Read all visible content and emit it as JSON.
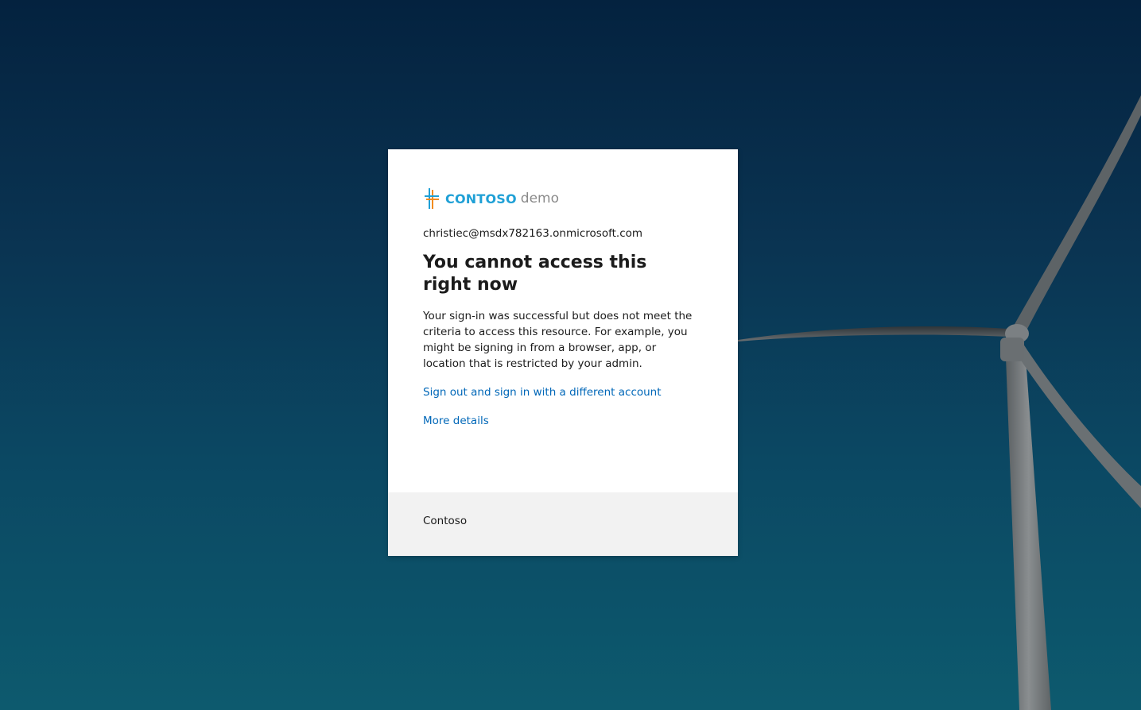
{
  "background": {
    "gradient_top": "#04223f",
    "gradient_bottom": "#0d5a6e",
    "image": "wind-turbine"
  },
  "logo": {
    "brand": "CONTOSO",
    "suffix": "demo",
    "brand_color": "#1fa0d6",
    "icon": "contoso-logo-icon"
  },
  "account": {
    "email": "christiec@msdx782163.onmicrosoft.com"
  },
  "message": {
    "title": "You cannot access this right now",
    "description": "Your sign-in was successful but does not meet the criteria to access this resource. For example, you might be signing in from a browser, app, or location that is restricted by your admin."
  },
  "links": {
    "sign_out": "Sign out and sign in with a different account",
    "more_details": "More details",
    "link_color": "#0067b8"
  },
  "footer": {
    "text": "Contoso"
  }
}
